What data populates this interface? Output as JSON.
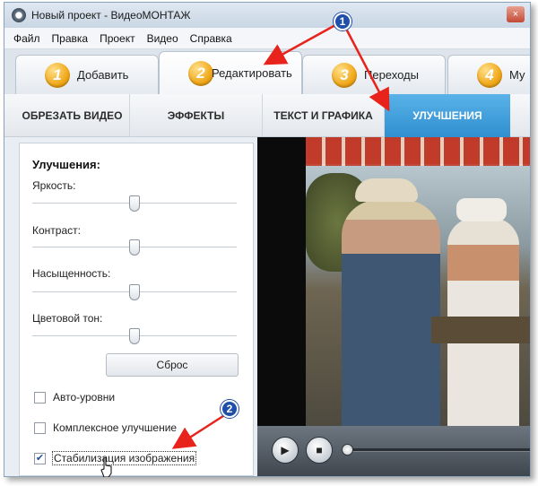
{
  "window": {
    "title": "Новый проект - ВидеоМОНТАЖ",
    "close_glyph": "×"
  },
  "menu": [
    "Файл",
    "Правка",
    "Проект",
    "Видео",
    "Справка"
  ],
  "steps": [
    {
      "num": "1",
      "label": "Добавить"
    },
    {
      "num": "2",
      "label": "Редактировать"
    },
    {
      "num": "3",
      "label": "Переходы"
    },
    {
      "num": "4",
      "label": "Му"
    }
  ],
  "subtabs": [
    "ОБРЕЗАТЬ ВИДЕО",
    "ЭФФЕКТЫ",
    "ТЕКСТ И ГРАФИКА",
    "УЛУЧШЕНИЯ"
  ],
  "panel": {
    "title": "Улучшения:",
    "sliders": [
      {
        "label": "Яркость:",
        "value": 0.5
      },
      {
        "label": "Контраст:",
        "value": 0.5
      },
      {
        "label": "Насыщенность:",
        "value": 0.5
      },
      {
        "label": "Цветовой тон:",
        "value": 0.5
      }
    ],
    "reset_label": "Сброс",
    "checkboxes": [
      {
        "label": "Авто-уровни",
        "checked": false
      },
      {
        "label": "Комплексное улучшение",
        "checked": false
      },
      {
        "label": "Стабилизация изображения",
        "checked": true
      }
    ]
  },
  "player": {
    "play_glyph": "▶",
    "stop_glyph": "■",
    "position": 0.0
  },
  "annotations": [
    "1",
    "2"
  ],
  "colors": {
    "accent": "#2f8fd0",
    "arrow": "#e8231c",
    "annotation": "#1f4fa8",
    "step_badge": "#f0a81a"
  }
}
